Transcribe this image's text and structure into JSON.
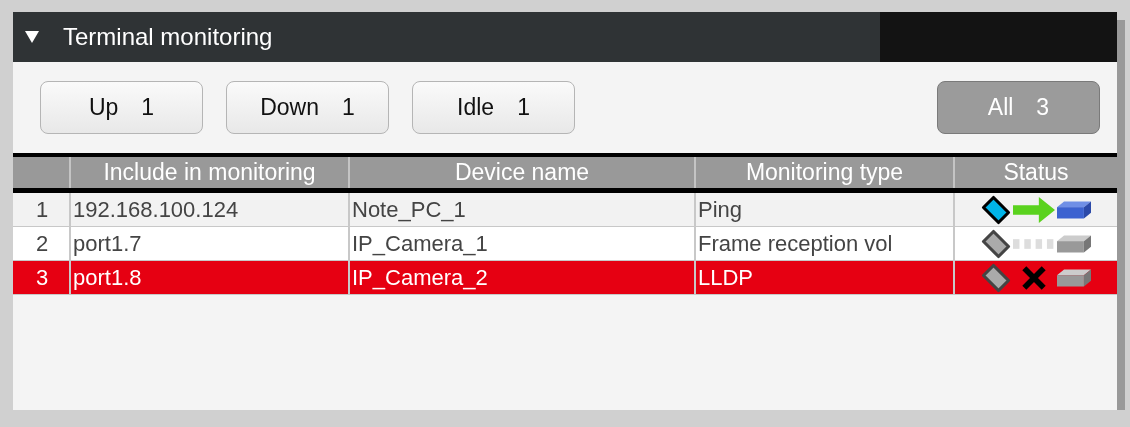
{
  "panel": {
    "title": "Terminal monitoring",
    "expanded": true
  },
  "filters": [
    {
      "label": "Up",
      "count": "1",
      "selected": false
    },
    {
      "label": "Down",
      "count": "1",
      "selected": false
    },
    {
      "label": "Idle",
      "count": "1",
      "selected": false
    },
    {
      "label": "All",
      "count": "3",
      "selected": true
    }
  ],
  "table": {
    "columns": [
      "",
      "Include in monitoring",
      "Device name",
      "Monitoring type",
      "Status"
    ],
    "rows": [
      {
        "index": "1",
        "target": "192.168.100.124",
        "device": "Note_PC_1",
        "type": "Ping",
        "kind": "up",
        "selected": false
      },
      {
        "index": "2",
        "target": "port1.7",
        "device": "IP_Camera_1",
        "type": "Frame reception vol",
        "kind": "idle",
        "selected": false
      },
      {
        "index": "3",
        "target": "port1.8",
        "device": "IP_Camera_2",
        "type": "LLDP",
        "kind": "down",
        "selected": true
      }
    ]
  }
}
